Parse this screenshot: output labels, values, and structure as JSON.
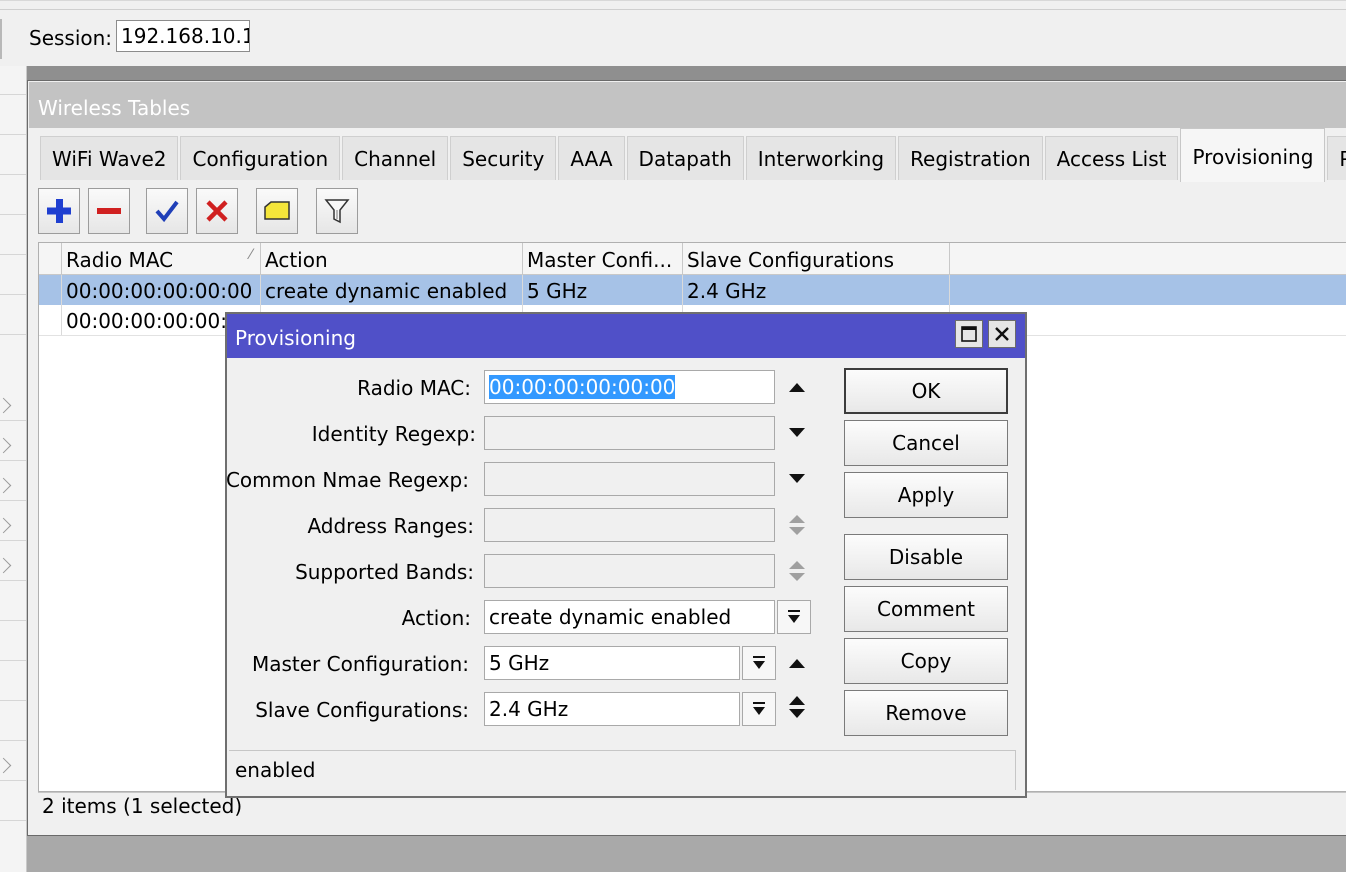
{
  "session": {
    "label": "Session:",
    "value": "192.168.10.1"
  },
  "window": {
    "title": "Wireless Tables",
    "tabs": [
      "WiFi Wave2",
      "Configuration",
      "Channel",
      "Security",
      "AAA",
      "Datapath",
      "Interworking",
      "Registration",
      "Access List",
      "Provisioning",
      "P"
    ],
    "active_tab": "Provisioning",
    "toolbar": [
      "add-icon",
      "remove-icon",
      "enable-icon",
      "disable-icon",
      "comment-icon",
      "filter-icon"
    ]
  },
  "table": {
    "columns": [
      "Radio MAC",
      "Action",
      "Master Confi...",
      "Slave Configurations"
    ],
    "rows": [
      {
        "radio_mac": "00:00:00:00:00:00",
        "action": "create dynamic enabled",
        "master": "5 GHz",
        "slave": "2.4 GHz",
        "selected": true
      },
      {
        "radio_mac": "00:00:00:00:00:00",
        "action": "",
        "master": "",
        "slave": "",
        "selected": false
      }
    ],
    "status": "2 items (1 selected)"
  },
  "dialog": {
    "title": "Provisioning",
    "fields": {
      "radio_mac": {
        "label": "Radio MAC:",
        "value": "00:00:00:00:00:00"
      },
      "identity_regexp": {
        "label": "Identity Regexp:",
        "value": ""
      },
      "common_name_regexp": {
        "label": "Common Nmae Regexp:",
        "value": ""
      },
      "address_ranges": {
        "label": "Address Ranges:",
        "value": ""
      },
      "supported_bands": {
        "label": "Supported Bands:",
        "value": ""
      },
      "action": {
        "label": "Action:",
        "value": "create dynamic enabled"
      },
      "master_configuration": {
        "label": "Master Configuration:",
        "value": "5 GHz"
      },
      "slave_configurations": {
        "label": "Slave Configurations:",
        "value": "2.4 GHz"
      }
    },
    "buttons": {
      "ok": "OK",
      "cancel": "Cancel",
      "apply": "Apply",
      "disable": "Disable",
      "comment": "Comment",
      "copy": "Copy",
      "remove": "Remove"
    },
    "status": "enabled"
  }
}
